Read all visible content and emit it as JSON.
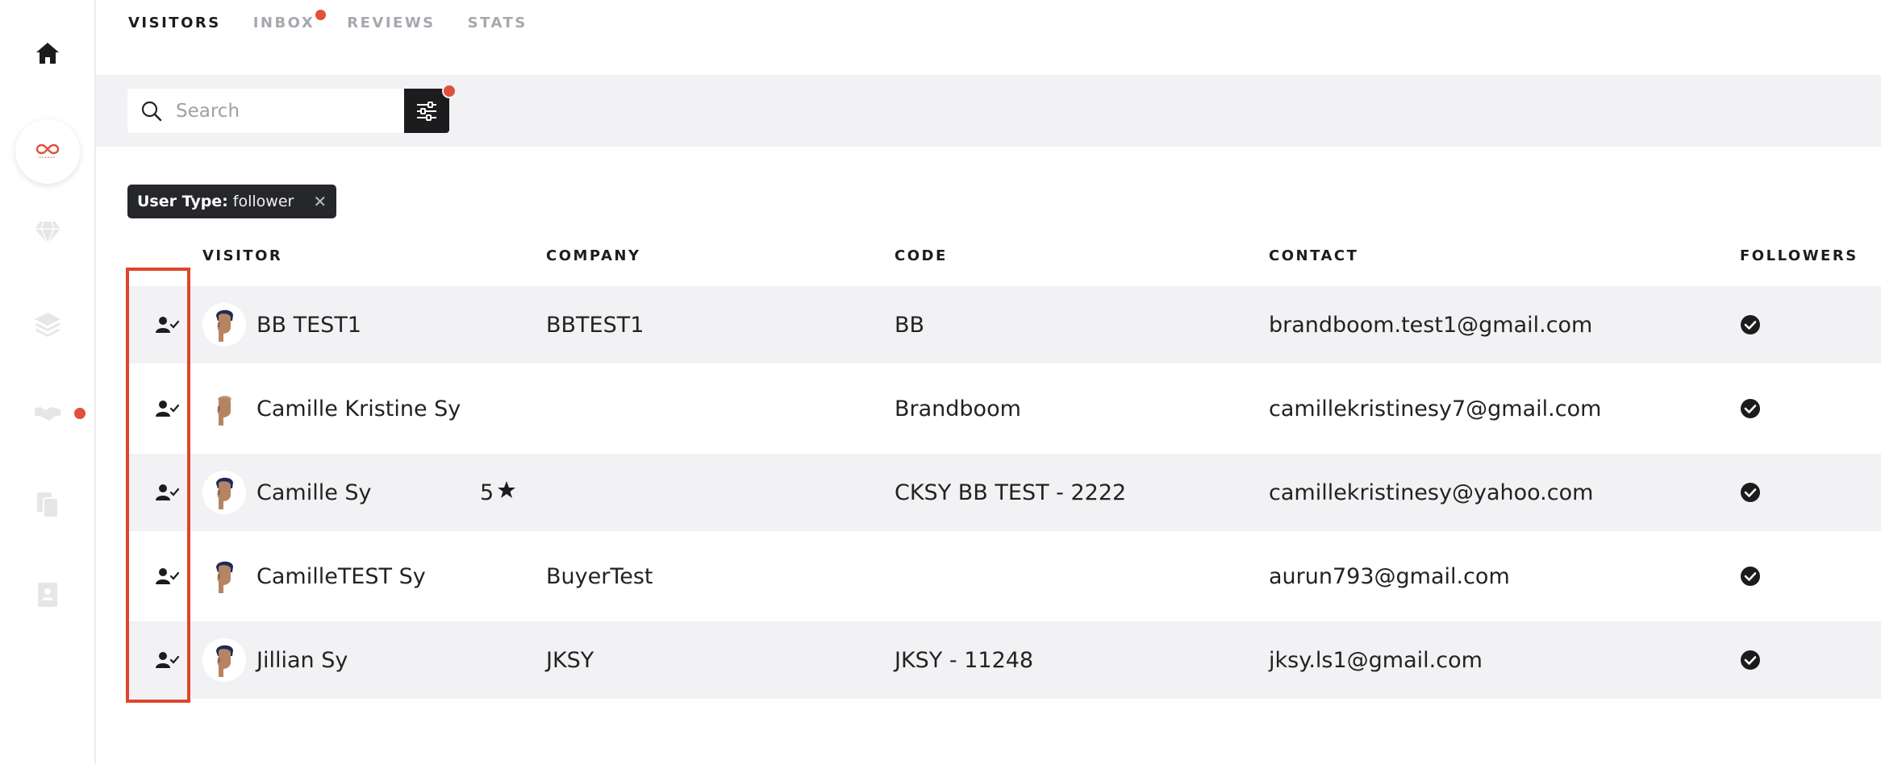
{
  "sidebar": {
    "items": [
      {
        "icon": "home-icon"
      },
      {
        "icon": "brand-logo-icon"
      },
      {
        "icon": "diamond-icon"
      },
      {
        "icon": "layers-icon"
      },
      {
        "icon": "handshake-icon",
        "badge": true
      },
      {
        "icon": "documents-icon"
      },
      {
        "icon": "contact-card-icon"
      }
    ]
  },
  "tabs": [
    {
      "label": "VISITORS",
      "active": true
    },
    {
      "label": "INBOX",
      "badge": true
    },
    {
      "label": "REVIEWS"
    },
    {
      "label": "STATS"
    }
  ],
  "search": {
    "placeholder": "Search"
  },
  "filter_chip": {
    "key": "User Type:",
    "value": "follower"
  },
  "table": {
    "columns": {
      "visitor": "VISITOR",
      "company": "COMPANY",
      "code": "CODE",
      "contact": "CONTACT",
      "followers": "FOLLOWERS"
    },
    "rows": [
      {
        "name": "BB TEST1",
        "rating": "",
        "company": "BBTEST1",
        "code": "BB",
        "contact": "brandboom.test1@gmail.com",
        "follower": true,
        "avatar": "dark-hair"
      },
      {
        "name": "Camille Kristine Sy",
        "rating": "",
        "company": "",
        "code": "Brandboom",
        "contact": "camillekristinesy7@gmail.com",
        "follower": true,
        "avatar": "bald"
      },
      {
        "name": "Camille Sy",
        "rating": "5",
        "company": "",
        "code": "CKSY BB TEST - 2222",
        "contact": "camillekristinesy@yahoo.com",
        "follower": true,
        "avatar": "dark-hair"
      },
      {
        "name": "CamilleTEST Sy",
        "rating": "",
        "company": "BuyerTest",
        "code": "",
        "contact": "aurun793@gmail.com",
        "follower": true,
        "avatar": "dark-hair"
      },
      {
        "name": "Jillian Sy",
        "rating": "",
        "company": "JKSY",
        "code": "JKSY - 11248",
        "contact": "jksy.ls1@gmail.com",
        "follower": true,
        "avatar": "dark-hair"
      }
    ]
  },
  "colors": {
    "accent": "#e0503a",
    "highlight": "#e0442a",
    "dark": "#1c1c1e",
    "band": "#f2f2f4"
  }
}
